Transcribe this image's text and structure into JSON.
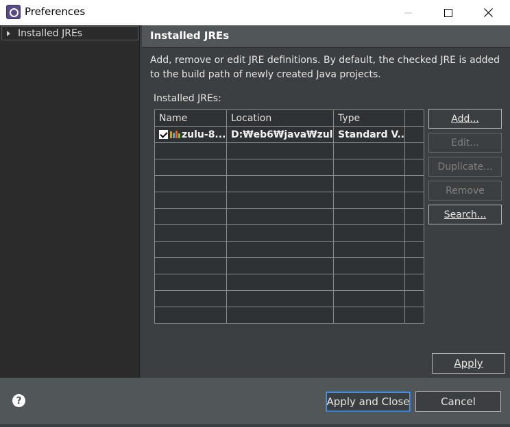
{
  "window": {
    "title": "Preferences",
    "minimize_glyph": "—",
    "maximize_glyph": "☐",
    "close_glyph": "✕"
  },
  "sidebar": {
    "items": [
      {
        "label": "Installed JREs",
        "icon": "expand-arrow-icon"
      }
    ]
  },
  "page": {
    "title": "Installed JREs",
    "description": "Add, remove or edit JRE definitions. By default, the checked JRE is added to the build path of newly created Java projects.",
    "table_label": "Installed JREs:"
  },
  "table": {
    "columns": [
      "Name",
      "Location",
      "Type"
    ],
    "rows": [
      {
        "checked": true,
        "name": "zulu-8...",
        "location": "D:₩eb6₩java₩zul...",
        "type": "Standard V..."
      }
    ],
    "empty_rows": 11
  },
  "buttons": {
    "add": {
      "label": "Add...",
      "enabled": true
    },
    "edit": {
      "label": "Edit...",
      "enabled": false
    },
    "duplicate": {
      "label": "Duplicate...",
      "enabled": false
    },
    "remove": {
      "label": "Remove",
      "enabled": false
    },
    "search": {
      "label": "Search...",
      "enabled": true
    },
    "apply": "Apply",
    "apply_and_close": "Apply and Close",
    "cancel": "Cancel",
    "help": "?"
  },
  "colors": {
    "dark_background": "#3c3f41",
    "header_background": "#515658",
    "tree_background": "#2b2b2b",
    "focus_border": "#2f7bd6"
  }
}
